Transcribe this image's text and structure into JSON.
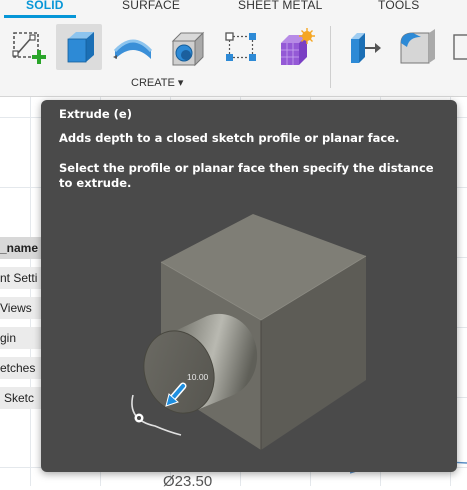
{
  "toolbar": {
    "tabs": [
      "SOLID",
      "SURFACE",
      "SHEET METAL",
      "TOOLS"
    ],
    "active_tab": "SOLID",
    "create_label": "CREATE ▾",
    "icons": [
      "create-sketch-icon",
      "extrude-icon",
      "revolve-icon",
      "hole-icon",
      "pattern-icon",
      "form-icon",
      "press-pull-icon",
      "fillet-icon"
    ]
  },
  "browser": {
    "items": [
      "_name",
      "nt Setti",
      "Views",
      "gin",
      "etches",
      "Sketc"
    ]
  },
  "canvas": {
    "dimension_label": "Ø23.50"
  },
  "tooltip": {
    "title": "Extrude (e)",
    "description": "Adds depth to a closed sketch profile or planar face.",
    "instruction": "Select the profile or planar face then specify the distance to extrude.",
    "distance_value": "10.00"
  },
  "colors": {
    "accent": "#0696d7",
    "tooltip_bg": "#4a4a4a",
    "toolbar_bg": "#f5f5f5",
    "manipulator_blue": "#1e8fe0"
  }
}
